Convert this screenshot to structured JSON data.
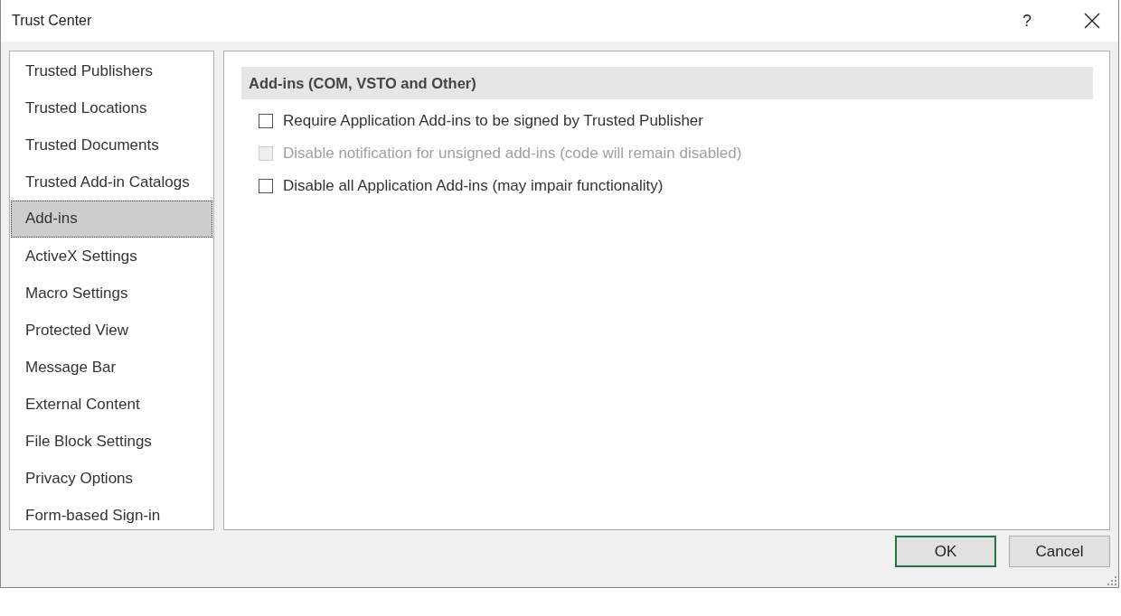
{
  "window": {
    "title": "Trust Center",
    "help": "?"
  },
  "sidebar": {
    "items": [
      {
        "label": "Trusted Publishers",
        "selected": false
      },
      {
        "label": "Trusted Locations",
        "selected": false
      },
      {
        "label": "Trusted Documents",
        "selected": false
      },
      {
        "label": "Trusted Add-in Catalogs",
        "selected": false
      },
      {
        "label": "Add-ins",
        "selected": true
      },
      {
        "label": "ActiveX Settings",
        "selected": false
      },
      {
        "label": "Macro Settings",
        "selected": false
      },
      {
        "label": "Protected View",
        "selected": false
      },
      {
        "label": "Message Bar",
        "selected": false
      },
      {
        "label": "External Content",
        "selected": false
      },
      {
        "label": "File Block Settings",
        "selected": false
      },
      {
        "label": "Privacy Options",
        "selected": false
      },
      {
        "label": "Form-based Sign-in",
        "selected": false
      }
    ]
  },
  "section": {
    "title": "Add-ins (COM, VSTO and Other)",
    "options": [
      {
        "label": "Require Application Add-ins to be signed by Trusted Publisher",
        "checked": false,
        "disabled": false
      },
      {
        "label": "Disable notification for unsigned add-ins (code will remain disabled)",
        "checked": false,
        "disabled": true
      },
      {
        "label": "Disable all Application Add-ins (may impair functionality)",
        "checked": false,
        "disabled": false
      }
    ]
  },
  "buttons": [
    {
      "label": "OK",
      "default": true
    },
    {
      "label": "Cancel",
      "default": false
    }
  ]
}
